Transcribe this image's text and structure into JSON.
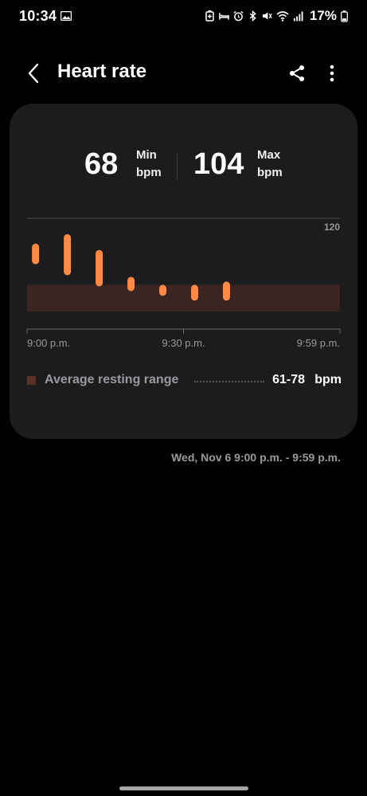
{
  "status_bar": {
    "time": "10:34",
    "battery": "17%",
    "icons": [
      "photo-icon",
      "battery-saver-icon",
      "sleep-icon",
      "alarm-icon",
      "bluetooth-icon",
      "mute-icon",
      "wifi-icon",
      "signal-icon",
      "battery-icon"
    ]
  },
  "header": {
    "title": "Heart rate",
    "icons": [
      "back-arrow-icon",
      "share-icon",
      "more-vert-icon"
    ]
  },
  "summary": {
    "min_value": "68",
    "min_label": "Min",
    "min_unit": "bpm",
    "max_value": "104",
    "max_label": "Max",
    "max_unit": "bpm"
  },
  "chart_data": {
    "type": "bar",
    "y_max_label": "120",
    "ylim": [
      0,
      120
    ],
    "x_labels": [
      "9:00 p.m.",
      "9:30 p.m.",
      "9:59 p.m."
    ],
    "x_range_minutes": [
      0,
      59
    ],
    "resting_band": [
      61,
      78
    ],
    "bars": [
      {
        "minute": 1,
        "low": 91,
        "high": 104
      },
      {
        "minute": 7,
        "low": 84,
        "high": 110
      },
      {
        "minute": 13,
        "low": 77,
        "high": 100
      },
      {
        "minute": 19,
        "low": 74,
        "high": 83
      },
      {
        "minute": 25,
        "low": 71,
        "high": 78
      },
      {
        "minute": 31,
        "low": 68,
        "high": 78
      },
      {
        "minute": 37,
        "low": 68,
        "high": 80
      }
    ],
    "bar_color": "#ff8a45",
    "band_color": "#3a2520"
  },
  "legend": {
    "label": "Average resting range",
    "range": "61-78",
    "unit": "bpm"
  },
  "date_range": "Wed, Nov 6 9:00 p.m. - 9:59 p.m."
}
